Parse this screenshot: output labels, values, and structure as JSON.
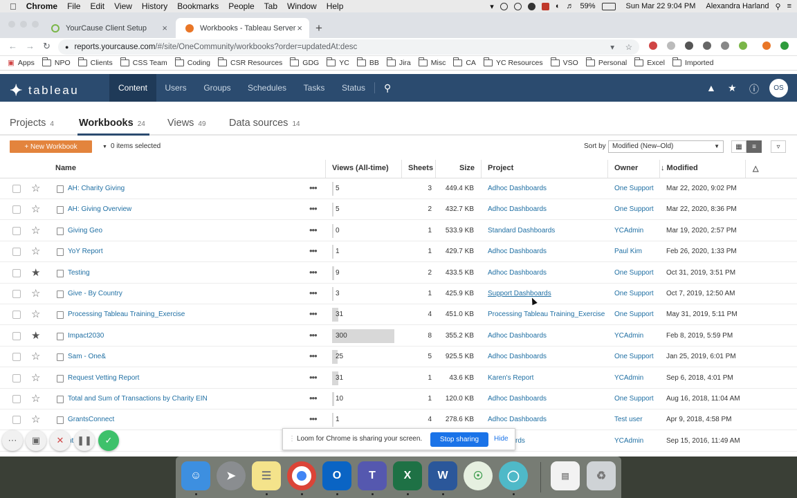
{
  "menubar": {
    "app": "Chrome",
    "items": [
      "File",
      "Edit",
      "View",
      "History",
      "Bookmarks",
      "People",
      "Tab",
      "Window",
      "Help"
    ],
    "battery": "59%",
    "datetime": "Sun Mar 22  9:04 PM",
    "user": "Alexandra Harland"
  },
  "browser": {
    "tabs": [
      {
        "title": "YourCause Client Setup",
        "active": false
      },
      {
        "title": "Workbooks - Tableau Server",
        "active": true
      }
    ],
    "url_host": "reports.yourcause.com",
    "url_path": "/#/site/OneCommunity/workbooks?order=updatedAt:desc",
    "bookmarks": [
      "Apps",
      "NPO",
      "Clients",
      "CSS Team",
      "Coding",
      "CSR Resources",
      "GDG",
      "YC",
      "BB",
      "Jira",
      "Misc",
      "CA",
      "YC Resources",
      "VSO",
      "Personal",
      "Excel",
      "Imported"
    ]
  },
  "tableau": {
    "logo": "+ableau",
    "nav": [
      "Content",
      "Users",
      "Groups",
      "Schedules",
      "Tasks",
      "Status"
    ],
    "active_nav": "Content",
    "avatar": "OS",
    "content_tabs": [
      {
        "label": "Projects",
        "count": "4"
      },
      {
        "label": "Workbooks",
        "count": "24"
      },
      {
        "label": "Views",
        "count": "49"
      },
      {
        "label": "Data sources",
        "count": "14"
      }
    ],
    "new_workbook": "+ New Workbook",
    "selected": "0 items selected",
    "sort_label": "Sort by",
    "sort_value": "Modified (New–Old)",
    "columns": [
      "Name",
      "Views (All-time)",
      "Sheets",
      "Size",
      "Project",
      "Owner",
      "↓ Modified"
    ],
    "rows": [
      {
        "name": "AH: Charity Giving",
        "views": "5",
        "sheets": "3",
        "size": "449.4 KB",
        "project": "Adhoc Dashboards",
        "owner": "One Support",
        "modified": "Mar 22, 2020, 9:02 PM",
        "fav": false
      },
      {
        "name": "AH: Giving Overview",
        "views": "5",
        "sheets": "2",
        "size": "432.7 KB",
        "project": "Adhoc Dashboards",
        "owner": "One Support",
        "modified": "Mar 22, 2020, 8:36 PM",
        "fav": false
      },
      {
        "name": "Giving Geo",
        "views": "0",
        "sheets": "1",
        "size": "533.9 KB",
        "project": "Standard Dashboards",
        "owner": "YCAdmin",
        "modified": "Mar 19, 2020, 2:57 PM",
        "fav": false
      },
      {
        "name": "YoY Report",
        "views": "1",
        "sheets": "1",
        "size": "429.7 KB",
        "project": "Adhoc Dashboards",
        "owner": "Paul Kim",
        "modified": "Feb 26, 2020, 1:33 PM",
        "fav": false
      },
      {
        "name": "Testing",
        "views": "9",
        "sheets": "2",
        "size": "433.5 KB",
        "project": "Adhoc Dashboards",
        "owner": "One Support",
        "modified": "Oct 31, 2019, 3:51 PM",
        "fav": true
      },
      {
        "name": "Give - By Country",
        "views": "3",
        "sheets": "1",
        "size": "425.9 KB",
        "project": "Support Dashboards",
        "owner": "One Support",
        "modified": "Oct 7, 2019, 12:50 AM",
        "fav": false
      },
      {
        "name": "Processing Tableau Training_Exercise",
        "views": "31",
        "sheets": "4",
        "size": "451.0 KB",
        "project": "Processing Tableau Training_Exercise",
        "owner": "One Support",
        "modified": "May 31, 2019, 5:11 PM",
        "fav": false
      },
      {
        "name": "Impact2030",
        "views": "300",
        "sheets": "8",
        "size": "355.2 KB",
        "project": "Adhoc Dashboards",
        "owner": "YCAdmin",
        "modified": "Feb 8, 2019, 5:59 PM",
        "fav": true
      },
      {
        "name": "Sam - One&",
        "views": "25",
        "sheets": "5",
        "size": "925.5 KB",
        "project": "Adhoc Dashboards",
        "owner": "One Support",
        "modified": "Jan 25, 2019, 6:01 PM",
        "fav": false
      },
      {
        "name": "Request Vetting Report",
        "views": "31",
        "sheets": "1",
        "size": "43.6 KB",
        "project": "Karen's Report",
        "owner": "YCAdmin",
        "modified": "Sep 6, 2018, 4:01 PM",
        "fav": false
      },
      {
        "name": "Total and Sum of Transactions by Charity EIN",
        "views": "10",
        "sheets": "1",
        "size": "120.0 KB",
        "project": "Adhoc Dashboards",
        "owner": "One Support",
        "modified": "Aug 16, 2018, 11:04 AM",
        "fav": false
      },
      {
        "name": "GrantsConnect",
        "views": "1",
        "sheets": "4",
        "size": "278.6 KB",
        "project": "Adhoc Dashboards",
        "owner": "Test user",
        "modified": "Apr 9, 2018, 4:58 PM",
        "fav": false
      },
      {
        "name": "nt",
        "views": "",
        "sheets": "",
        "size": "",
        "project": "Dashboards",
        "owner": "YCAdmin",
        "modified": "Sep 15, 2016, 11:49 AM",
        "fav": false
      }
    ],
    "max_views": 300
  },
  "loom": {
    "message": "Loom for Chrome is sharing your screen.",
    "stop": "Stop sharing",
    "hide": "Hide"
  },
  "dock": [
    "finder",
    "launchpad",
    "notes",
    "chrome",
    "outlook",
    "teams",
    "excel",
    "word",
    "app-green",
    "app-blue",
    "preview",
    "trash"
  ]
}
